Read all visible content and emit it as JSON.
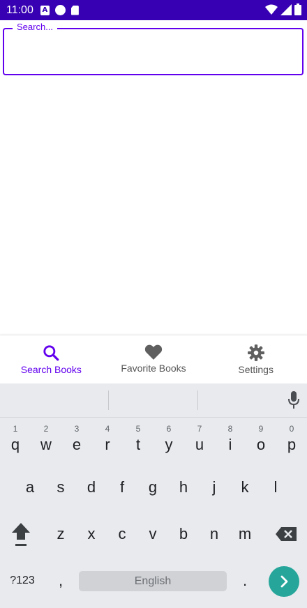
{
  "status_bar": {
    "time": "11:00",
    "icons": [
      "a-icon",
      "p-icon",
      "sd-card-icon",
      "wifi-icon",
      "signal-icon",
      "battery-icon"
    ],
    "background": "#3700b3"
  },
  "search": {
    "label": "Search...",
    "value": ""
  },
  "bottom_nav": {
    "items": [
      {
        "label": "Search Books",
        "icon": "search-icon",
        "active": true
      },
      {
        "label": "Favorite Books",
        "icon": "heart-icon",
        "active": false
      },
      {
        "label": "Settings",
        "icon": "gear-icon",
        "active": false
      }
    ],
    "accent": "#6200ee"
  },
  "keyboard": {
    "row1": [
      {
        "c": "q",
        "h": "1"
      },
      {
        "c": "w",
        "h": "2"
      },
      {
        "c": "e",
        "h": "3"
      },
      {
        "c": "r",
        "h": "4"
      },
      {
        "c": "t",
        "h": "5"
      },
      {
        "c": "y",
        "h": "6"
      },
      {
        "c": "u",
        "h": "7"
      },
      {
        "c": "i",
        "h": "8"
      },
      {
        "c": "o",
        "h": "9"
      },
      {
        "c": "p",
        "h": "0"
      }
    ],
    "row2": [
      "a",
      "s",
      "d",
      "f",
      "g",
      "h",
      "j",
      "k",
      "l"
    ],
    "row3": [
      "z",
      "x",
      "c",
      "v",
      "b",
      "n",
      "m"
    ],
    "symbols_label": "?123",
    "comma": ",",
    "space_label": "English",
    "period": ".",
    "go_color": "#26a69a"
  }
}
